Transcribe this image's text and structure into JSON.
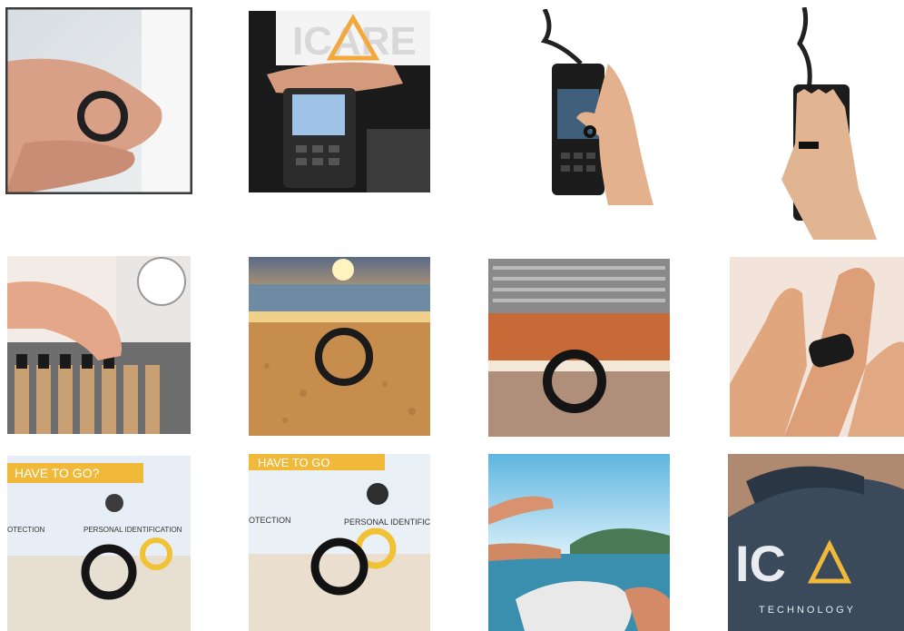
{
  "gallery": {
    "tiles": [
      {
        "id": "hands-holding-ring"
      },
      {
        "id": "icare-terminal",
        "sign_text": "ICARE"
      },
      {
        "id": "terminal-ring-tap"
      },
      {
        "id": "terminal-hand-ring"
      },
      {
        "id": "vending-ring"
      },
      {
        "id": "beach-sunset-ring"
      },
      {
        "id": "tennis-court-ring"
      },
      {
        "id": "finger-ring-closeup"
      },
      {
        "id": "banner-rings-black-yellow",
        "banner_text": "HAVE TO GO?",
        "left_text": "OTECTION",
        "right_text": "PERSONAL IDENTIFICATION"
      },
      {
        "id": "banner-rings-closeup",
        "banner_text": "HAVE TO GO",
        "left_text": "OTECTION",
        "right_text": "PERSONAL IDENTIFICATION"
      },
      {
        "id": "jetski-ring"
      },
      {
        "id": "shirt-logo",
        "logo_text": "IC",
        "sub_text": "TECHNOLOGY"
      }
    ]
  }
}
